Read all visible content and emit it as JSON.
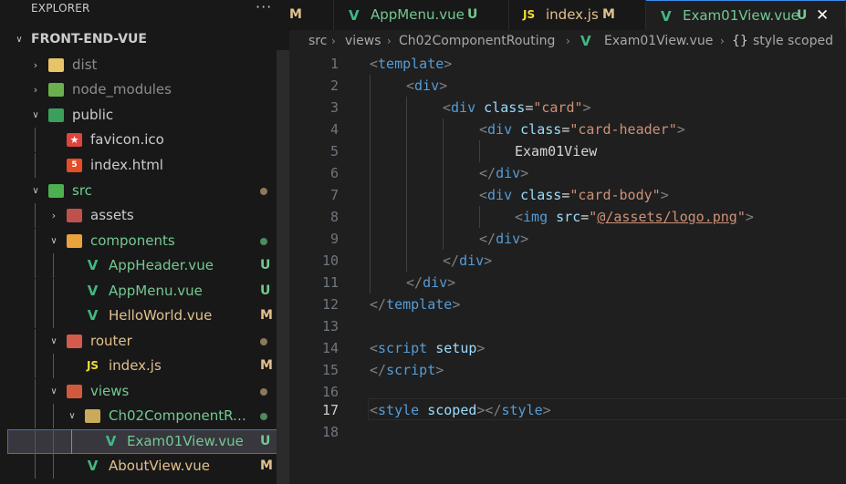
{
  "explorer": {
    "title": "EXPLORER",
    "more": "···",
    "project": "FRONT-END-VUE",
    "items": [
      {
        "label": "dist"
      },
      {
        "label": "node_modules"
      },
      {
        "label": "public"
      },
      {
        "label": "favicon.ico"
      },
      {
        "label": "index.html"
      },
      {
        "label": "src"
      },
      {
        "label": "assets"
      },
      {
        "label": "components"
      },
      {
        "label": "AppHeader.vue",
        "status": "U"
      },
      {
        "label": "AppMenu.vue",
        "status": "U"
      },
      {
        "label": "HelloWorld.vue",
        "status": "M"
      },
      {
        "label": "router"
      },
      {
        "label": "index.js",
        "status": "M"
      },
      {
        "label": "views"
      },
      {
        "label": "Ch02ComponentRouting"
      },
      {
        "label": "Exam01View.vue",
        "status": "U"
      },
      {
        "label": "AboutView.vue",
        "status": "M"
      }
    ],
    "icon_text": {
      "js": "JS",
      "vue": "V",
      "html": "5",
      "star": "★"
    }
  },
  "tabs": [
    {
      "label": "",
      "status": "M",
      "active": false
    },
    {
      "label": "AppMenu.vue",
      "status": "U",
      "icon": "V",
      "active": false
    },
    {
      "label": "index.js",
      "status": "M",
      "icon": "JS",
      "active": false
    },
    {
      "label": "Exam01View.vue",
      "status": "U",
      "icon": "V",
      "active": true,
      "close": "✕"
    }
  ],
  "breadcrumb": {
    "items": [
      "src",
      "views",
      "Ch02ComponentRouting",
      "Exam01View.vue",
      "style scoped"
    ],
    "sep": "›",
    "vue_icon": "V",
    "style_icon": "{}"
  },
  "editor": {
    "current_line": 17,
    "lines": [
      {
        "n": "1"
      },
      {
        "n": "2"
      },
      {
        "n": "3"
      },
      {
        "n": "4"
      },
      {
        "n": "5"
      },
      {
        "n": "6"
      },
      {
        "n": "7"
      },
      {
        "n": "8"
      },
      {
        "n": "9"
      },
      {
        "n": "10"
      },
      {
        "n": "11"
      },
      {
        "n": "12"
      },
      {
        "n": "13"
      },
      {
        "n": "14"
      },
      {
        "n": "15"
      },
      {
        "n": "16"
      },
      {
        "n": "17"
      },
      {
        "n": "18"
      }
    ],
    "code": {
      "l1_tag": "template",
      "l2_tag": "div",
      "l3_tag": "div",
      "l3_attr": "class",
      "l3_val": "\"card\"",
      "l4_tag": "div",
      "l4_attr": "class",
      "l4_val": "\"card-header\"",
      "l5_text": "Exam01View",
      "l6_tag": "div",
      "l7_tag": "div",
      "l7_attr": "class",
      "l7_val": "\"card-body\"",
      "l8_tag": "img",
      "l8_attr": "src",
      "l8_val": "@/assets/logo.png",
      "l9_tag": "div",
      "l10_tag": "div",
      "l11_tag": "div",
      "l12_tag": "template",
      "l14_tag": "script",
      "l14_attr": "setup",
      "l15_tag": "script",
      "l17_tag": "style",
      "l17_attr": "scoped",
      "l17_close": "style"
    }
  },
  "colors": {
    "accent": "#3b8eea",
    "untracked": "#73c991",
    "modified": "#e2c08d",
    "vue_green": "#41b883",
    "js_yellow": "#f1dd35"
  }
}
